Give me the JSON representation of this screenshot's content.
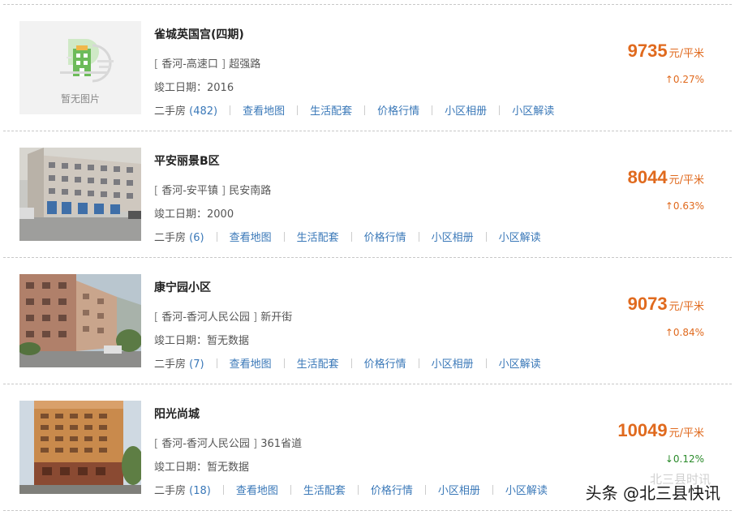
{
  "listings": [
    {
      "name": "雀城英国宫(四期)",
      "district": "香河-高速口",
      "street": "超强路",
      "completion_label": "竣工日期：",
      "completion": "2016",
      "links": {
        "secondhand_label": "二手房",
        "secondhand_count": "(482)",
        "map": "查看地图",
        "amenities": "生活配套",
        "market": "价格行情",
        "album": "小区相册",
        "analysis": "小区解读"
      },
      "price": "9735",
      "unit": "元/平米",
      "change": "↑0.27%",
      "trend": "up",
      "thumb_caption": "暂无图片"
    },
    {
      "name": "平安丽景B区",
      "district": "香河-安平镇",
      "street": "民安南路",
      "completion_label": "竣工日期：",
      "completion": "2000",
      "links": {
        "secondhand_label": "二手房",
        "secondhand_count": "(6)",
        "map": "查看地图",
        "amenities": "生活配套",
        "market": "价格行情",
        "album": "小区相册",
        "analysis": "小区解读"
      },
      "price": "8044",
      "unit": "元/平米",
      "change": "↑0.63%",
      "trend": "up"
    },
    {
      "name": "康宁园小区",
      "district": "香河-香河人民公园",
      "street": "新开街",
      "completion_label": "竣工日期：",
      "completion": "暂无数据",
      "links": {
        "secondhand_label": "二手房",
        "secondhand_count": "(7)",
        "map": "查看地图",
        "amenities": "生活配套",
        "market": "价格行情",
        "album": "小区相册",
        "analysis": "小区解读"
      },
      "price": "9073",
      "unit": "元/平米",
      "change": "↑0.84%",
      "trend": "up"
    },
    {
      "name": "阳光尚城",
      "district": "香河-香河人民公园",
      "street": "361省道",
      "completion_label": "竣工日期：",
      "completion": "暂无数据",
      "links": {
        "secondhand_label": "二手房",
        "secondhand_count": "(18)",
        "map": "查看地图",
        "amenities": "生活配套",
        "market": "价格行情",
        "album": "小区相册",
        "analysis": "小区解读"
      },
      "price": "10049",
      "unit": "元/平米",
      "change": "↓0.12%",
      "trend": "down"
    }
  ],
  "watermark": "头条 @北三县快讯",
  "watermark_faint": "北三县时讯",
  "colors": {
    "price": "#e06a1e",
    "up": "#e06a1e",
    "down": "#2a8a2a",
    "link": "#3a78b8"
  }
}
